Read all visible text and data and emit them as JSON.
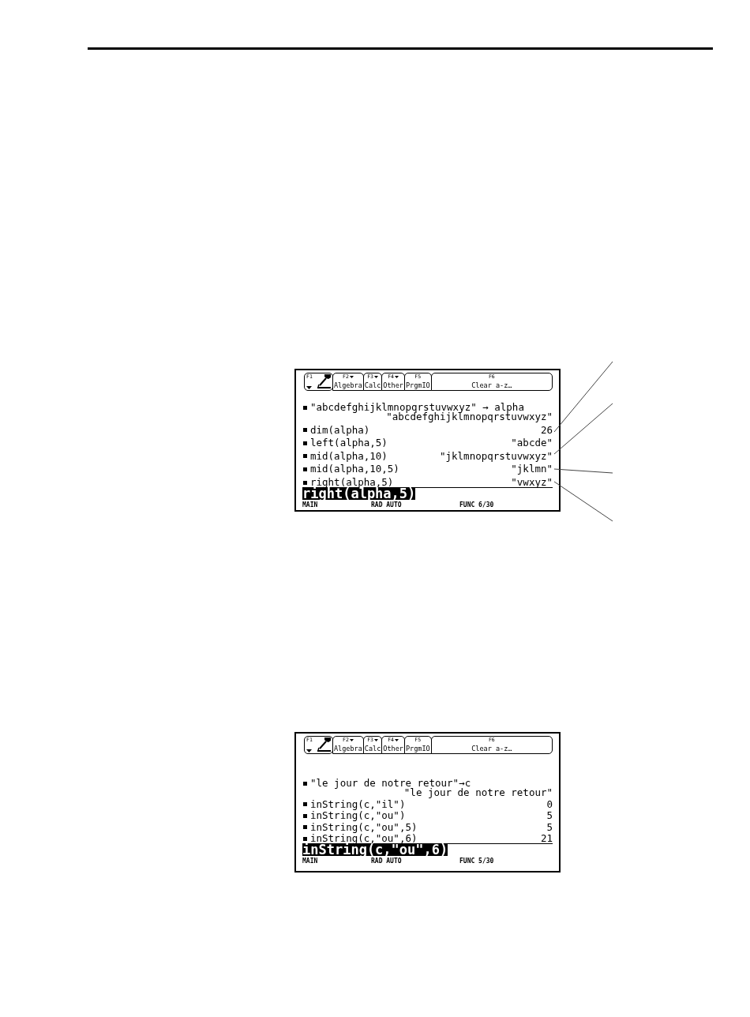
{
  "screens": [
    {
      "toolbar": [
        {
          "kind": "tools",
          "key": "F1",
          "dropdown": true
        },
        {
          "kind": "menu",
          "key": "F2",
          "label": "Algebra",
          "dropdown": true
        },
        {
          "kind": "menu",
          "key": "F3",
          "label": "Calc",
          "dropdown": true
        },
        {
          "kind": "menu",
          "key": "F4",
          "label": "Other",
          "dropdown": true
        },
        {
          "kind": "menu",
          "key": "F5",
          "label": "PrgmIO",
          "dropdown": false
        },
        {
          "kind": "menu",
          "key": "F6",
          "label": "Clear a-z…",
          "dropdown": false
        }
      ],
      "history": [
        {
          "input": "\"abcdefghijklmnopqrstuvwxyz\" → alpha",
          "output": "\"abcdefghijklmnopqrstuvwxyz\""
        },
        {
          "input": "dim(alpha)",
          "output": "26"
        },
        {
          "input": "left(alpha,5)",
          "output": "\"abcde\""
        },
        {
          "input": "mid(alpha,10)",
          "output": "\"jklmnopqrstuvwxyz\""
        },
        {
          "input": "mid(alpha,10,5)",
          "output": "\"jklmn\""
        },
        {
          "input": "right(alpha,5)",
          "output": "\"vwxyz\""
        }
      ],
      "entry_line": {
        "text": "right(alpha,5)",
        "selected": true
      },
      "status_bar": [
        "MAIN",
        "RAD AUTO",
        "FUNC 6/30"
      ]
    },
    {
      "toolbar": [
        {
          "kind": "tools",
          "key": "F1",
          "dropdown": true
        },
        {
          "kind": "menu",
          "key": "F2",
          "label": "Algebra",
          "dropdown": true
        },
        {
          "kind": "menu",
          "key": "F3",
          "label": "Calc",
          "dropdown": true
        },
        {
          "kind": "menu",
          "key": "F4",
          "label": "Other",
          "dropdown": true
        },
        {
          "kind": "menu",
          "key": "F5",
          "label": "PrgmIO",
          "dropdown": false
        },
        {
          "kind": "menu",
          "key": "F6",
          "label": "Clear a-z…",
          "dropdown": false
        }
      ],
      "history": [
        {
          "input": "\"le jour de notre retour\"→c",
          "output": "\"le jour de notre retour\""
        },
        {
          "input": "inString(c,\"il\")",
          "output": "0"
        },
        {
          "input": "inString(c,\"ou\")",
          "output": "5"
        },
        {
          "input": "inString(c,\"ou\",5)",
          "output": "5"
        },
        {
          "input": "inString(c,\"ou\",6)",
          "output": "21"
        }
      ],
      "entry_line": {
        "text": "inString(c,\"ou\",6)",
        "selected": true
      },
      "status_bar": [
        "MAIN",
        "RAD AUTO",
        "FUNC 5/30"
      ]
    }
  ]
}
